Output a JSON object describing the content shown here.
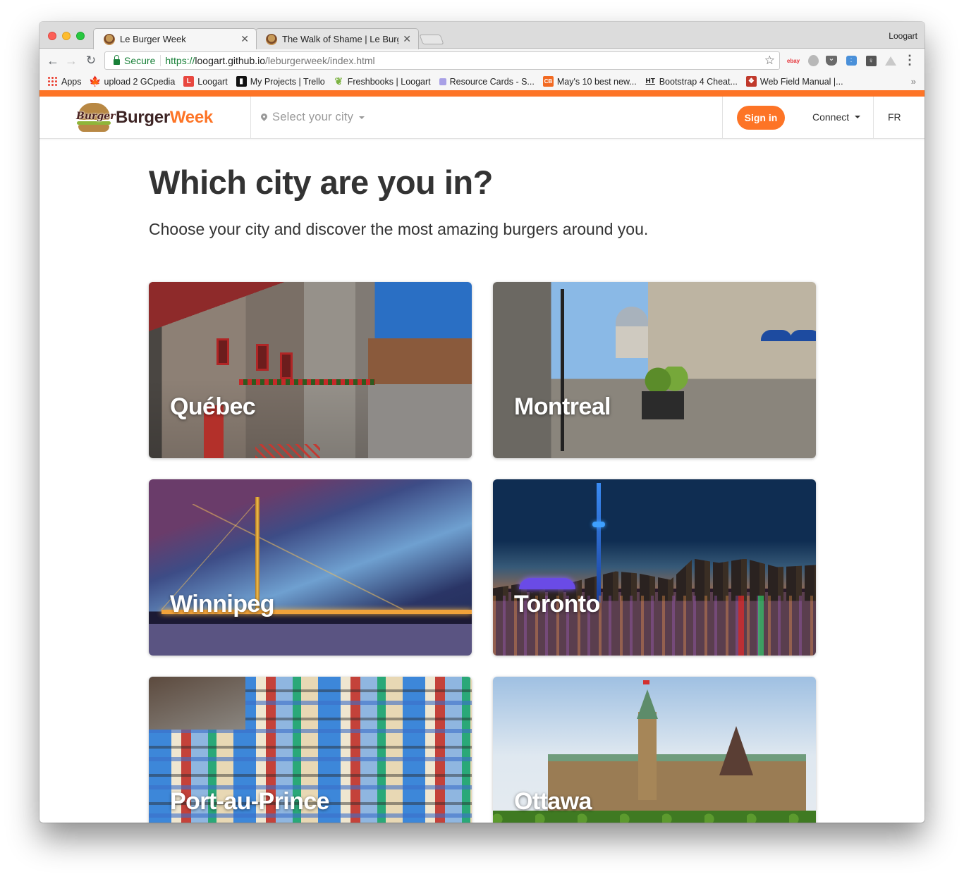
{
  "browser": {
    "tabs": [
      {
        "title": "Le Burger Week",
        "active": true,
        "favicon": "burger-favicon"
      },
      {
        "title": "The Walk of Shame | Le Burger",
        "active": false,
        "favicon": "burger-favicon"
      }
    ],
    "profile_name": "Loogart",
    "address_bar": {
      "secure_label": "Secure",
      "url_scheme": "https://",
      "url_host": "loogart.github.io",
      "url_path": "/leburgerweek/index.html"
    },
    "extensions": [
      "ebay-icon",
      "bubble-icon",
      "pocket-icon",
      "blue-extension-icon",
      "bulb-icon",
      "drive-icon"
    ],
    "bookmarks": [
      {
        "label": "Apps",
        "icon": "apps-grid-icon"
      },
      {
        "label": "upload 2 GCpedia",
        "icon": "maple-leaf-icon"
      },
      {
        "label": "Loogart",
        "icon": "loogart-icon"
      },
      {
        "label": "My Projects | Trello",
        "icon": "trello-icon"
      },
      {
        "label": "Freshbooks | Loogart",
        "icon": "leaf-icon"
      },
      {
        "label": "Resource Cards - S...",
        "icon": "resource-cards-icon"
      },
      {
        "label": "May's 10 best new...",
        "icon": "cb-icon"
      },
      {
        "label": "Bootstrap 4 Cheat...",
        "icon": "ht-icon"
      },
      {
        "label": "Web Field Manual |...",
        "icon": "web-field-manual-icon"
      }
    ],
    "bookmarks_overflow": "»",
    "icon_glyphs": {
      "back": "←",
      "forward": "→",
      "reload": "C",
      "star": "☆",
      "menu": "⋮",
      "close": "✕",
      "maple": "🍁",
      "leaf": "❦",
      "L": "L",
      "trello": "▮▮",
      "cb": "CB",
      "ht": "HT",
      "wfm": "❖"
    }
  },
  "brand": {
    "accent_color": "#fd7426",
    "logo_script": "Burger",
    "logo_word_part1": "Burger",
    "logo_word_part2": "Week"
  },
  "navbar": {
    "city_select_label": "Select your city",
    "sign_in_label": "Sign in",
    "connect_label": "Connect",
    "language_label": "FR"
  },
  "main": {
    "heading": "Which city are you in?",
    "subheading": "Choose your city and discover the most amazing burgers around you.",
    "cities": [
      {
        "name": "Québec"
      },
      {
        "name": "Montreal"
      },
      {
        "name": "Winnipeg"
      },
      {
        "name": "Toronto"
      },
      {
        "name": "Port-au-Prince"
      },
      {
        "name": "Ottawa"
      }
    ]
  }
}
